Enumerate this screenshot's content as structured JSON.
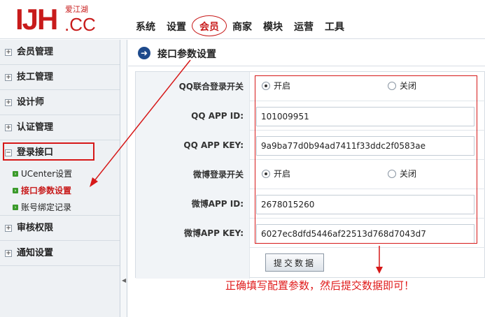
{
  "header": {
    "logo": {
      "letters": "IJH",
      "suffix": ".CC",
      "cn": "爱江湖"
    },
    "nav": [
      "系统",
      "设置",
      "会员",
      "商家",
      "模块",
      "运营",
      "工具"
    ],
    "active_nav": "会员"
  },
  "sidebar": {
    "groups": [
      {
        "label": "会员管理"
      },
      {
        "label": "技工管理"
      },
      {
        "label": "设计师"
      },
      {
        "label": "认证管理"
      },
      {
        "label": "登录接口"
      }
    ],
    "sub_items": [
      {
        "label": "UCenter设置"
      },
      {
        "label": "接口参数设置"
      },
      {
        "label": "账号绑定记录"
      }
    ],
    "after_groups": [
      {
        "label": "审核权限"
      },
      {
        "label": "通知设置"
      }
    ]
  },
  "main": {
    "title": "接口参数设置",
    "rows": [
      {
        "label": "QQ联合登录开关",
        "type": "radio",
        "options": [
          "开启",
          "关闭"
        ],
        "selected": "开启"
      },
      {
        "label": "QQ APP ID:",
        "type": "input",
        "value": "101009951"
      },
      {
        "label": "QQ APP KEY:",
        "type": "input",
        "value": "9a9ba77d0b94ad7411f33ddc2f0583ae"
      },
      {
        "label": "微博登录开关",
        "type": "radio",
        "options": [
          "开启",
          "关闭"
        ],
        "selected": "开启"
      },
      {
        "label": "微博APP ID:",
        "type": "input",
        "value": "2678015260"
      },
      {
        "label": "微博APP KEY:",
        "type": "input",
        "value": "6027ec8dfd5446af22513d768d7043d7"
      }
    ],
    "submit_label": "提交数据",
    "annotation": "正确填写配置参数，然后提交数据即可！"
  },
  "colors": {
    "accent": "#c81b1b",
    "annotation": "#e01b1b"
  }
}
